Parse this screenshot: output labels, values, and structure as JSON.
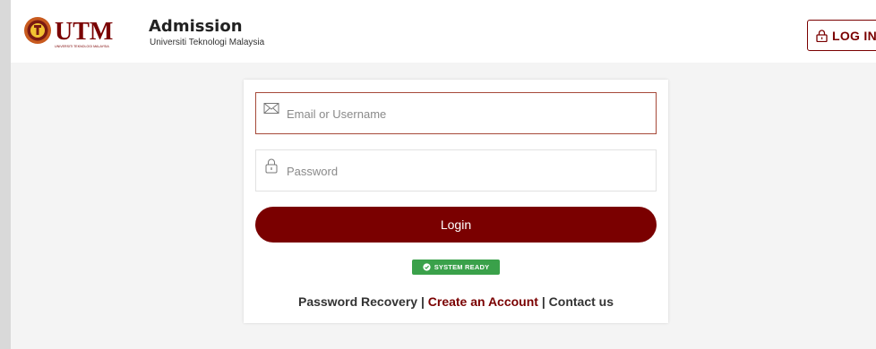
{
  "header": {
    "logo_text": "UTM",
    "logo_caption": "UNIVERSITI TEKNOLOGI MALAYSIA",
    "title": "Admission",
    "subtitle": "Universiti Teknologi Malaysia",
    "login_button": "LOG IN",
    "icons": {
      "login": "lock-icon",
      "logo": "utm-crest"
    }
  },
  "form": {
    "email_placeholder": "Email or Username",
    "password_placeholder": "Password",
    "login_button": "Login",
    "icons": {
      "email": "envelope-icon",
      "password": "lock-icon"
    }
  },
  "status": {
    "label": "SYSTEM READY",
    "icon": "check-circle-icon",
    "color": "#3aa14a"
  },
  "links": {
    "password_recovery": "Password Recovery",
    "separator": "|",
    "create_account": "Create an Account",
    "contact": "Contact us"
  },
  "colors": {
    "brand": "#7a0000",
    "background": "#f4f4f4"
  }
}
